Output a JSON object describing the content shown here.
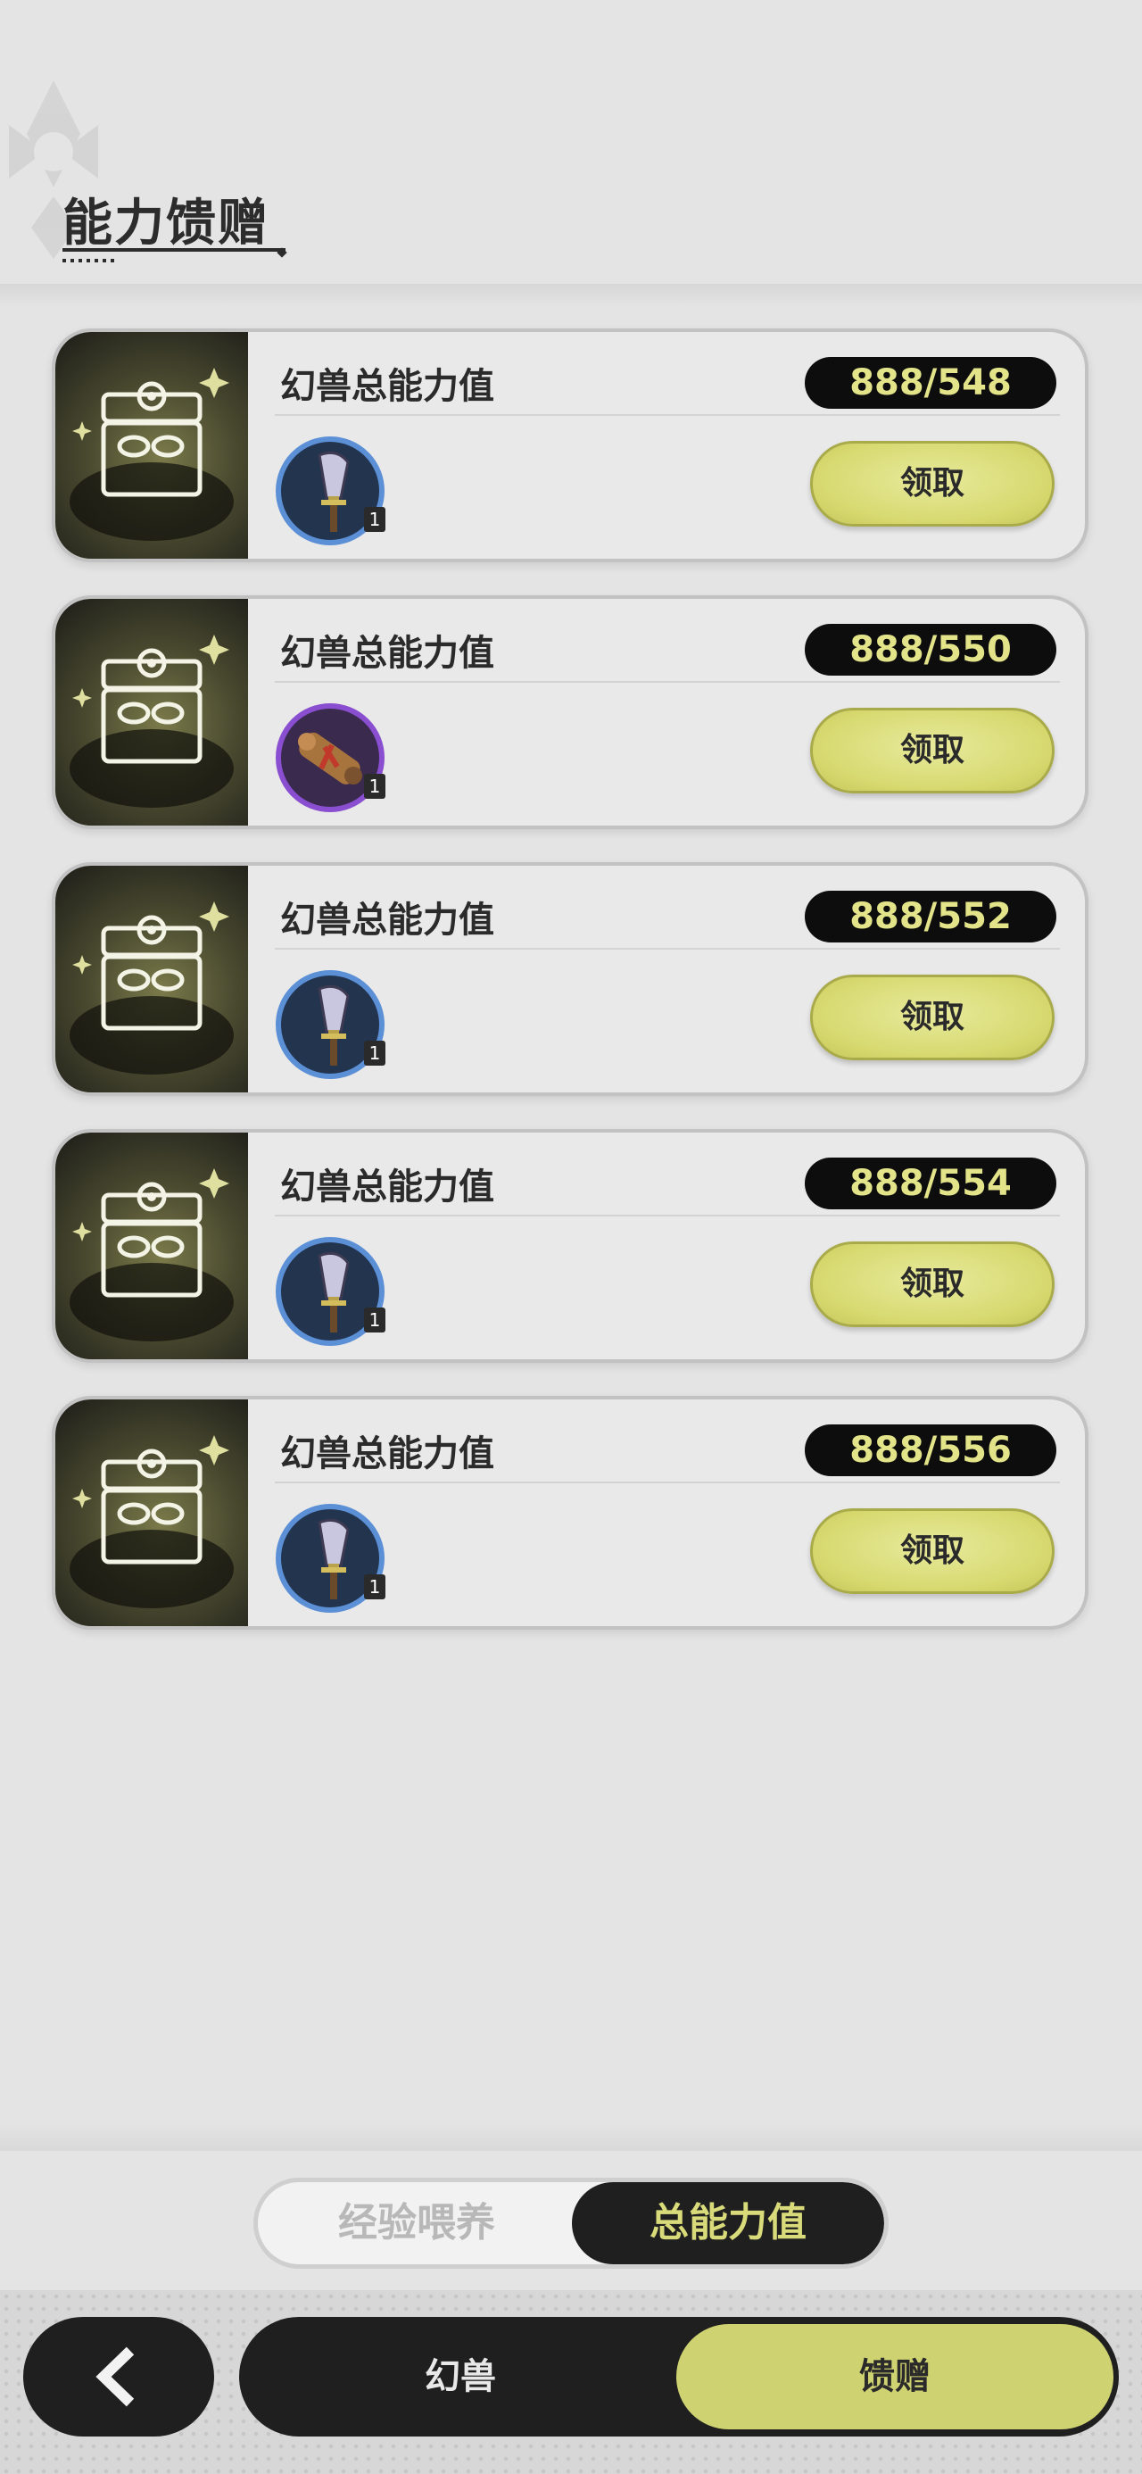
{
  "header": {
    "title": "能力馈赠"
  },
  "cards": [
    {
      "title": "幻兽总能力值",
      "progress": "888/548",
      "item_icon": "shovel-icon",
      "item_count": "1",
      "claim_label": "领取"
    },
    {
      "title": "幻兽总能力值",
      "progress": "888/550",
      "item_icon": "scroll-icon",
      "item_count": "1",
      "claim_label": "领取"
    },
    {
      "title": "幻兽总能力值",
      "progress": "888/552",
      "item_icon": "shovel-icon",
      "item_count": "1",
      "claim_label": "领取"
    },
    {
      "title": "幻兽总能力值",
      "progress": "888/554",
      "item_icon": "shovel-icon",
      "item_count": "1",
      "claim_label": "领取"
    },
    {
      "title": "幻兽总能力值",
      "progress": "888/556",
      "item_icon": "shovel-icon",
      "item_count": "1",
      "claim_label": "领取"
    }
  ],
  "tabs": {
    "exp": "经验喂养",
    "total": "总能力值",
    "active": "total"
  },
  "nav": {
    "beast": "幻兽",
    "gift": "馈赠",
    "active": "gift"
  },
  "colors": {
    "accent": "#cfd270",
    "dark": "#1f1f1f",
    "progress_text": "#e3e48a"
  }
}
